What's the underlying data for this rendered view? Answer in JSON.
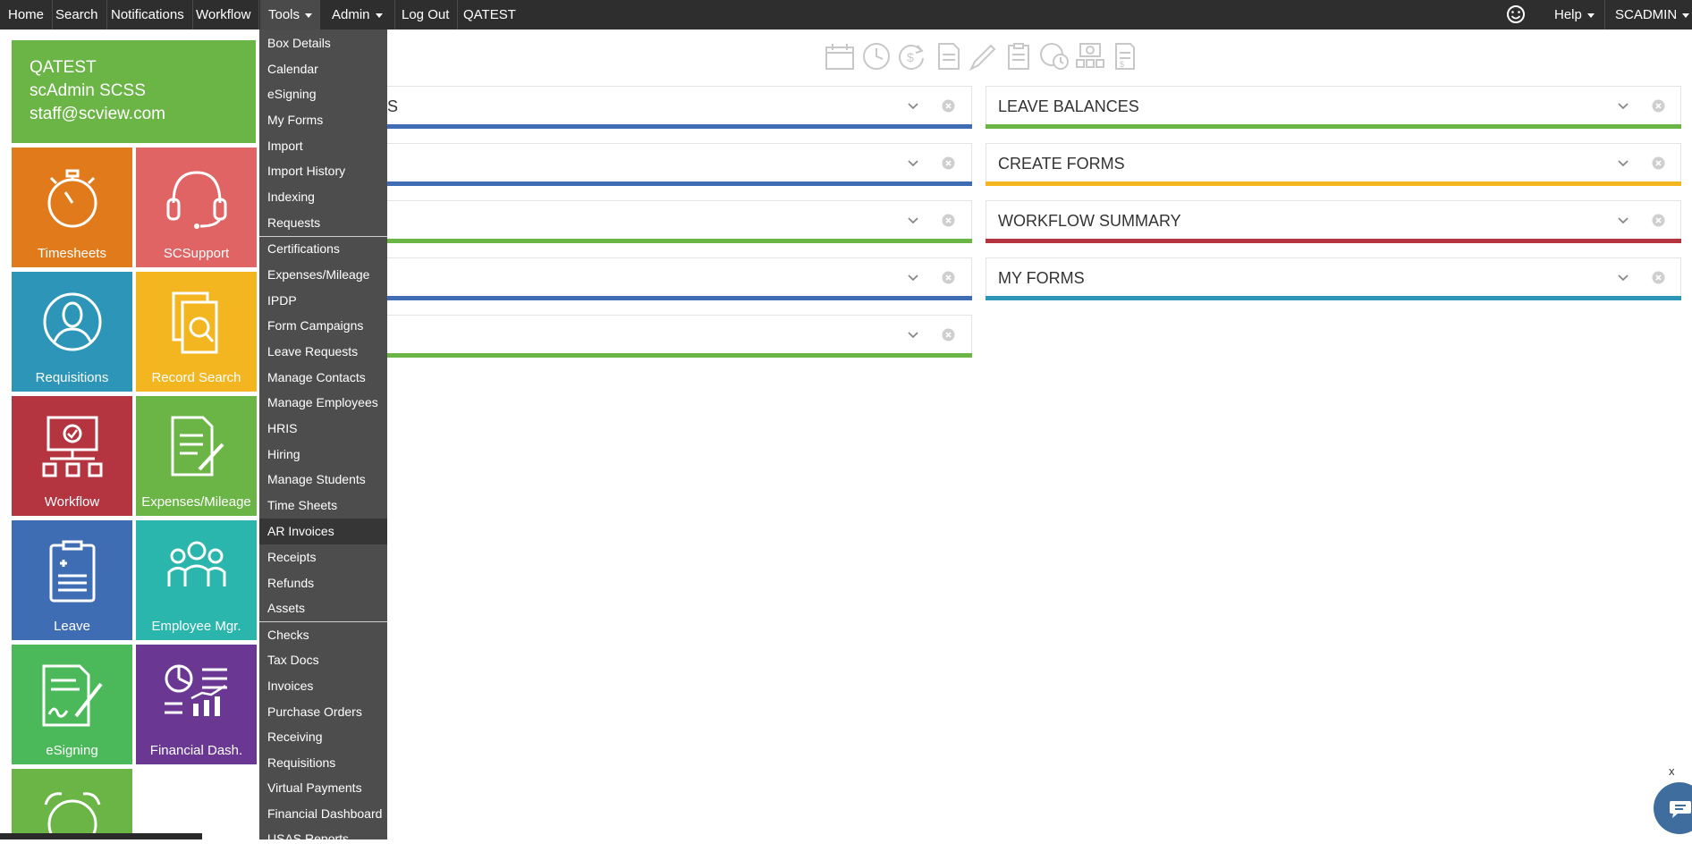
{
  "nav": {
    "home": "Home",
    "search": "Search",
    "notifications": "Notifications",
    "workflow": "Workflow",
    "tools": "Tools",
    "admin": "Admin",
    "logout": "Log Out",
    "site": "QATEST",
    "help": "Help",
    "user": "SCADMIN"
  },
  "user": {
    "site": "QATEST",
    "name": "scAdmin SCSS",
    "email": "staff@scview.com"
  },
  "tiles": [
    {
      "label": "Timesheets",
      "color": "#e07a1b",
      "icon": "stopwatch-icon"
    },
    {
      "label": "SCSupport",
      "color": "#e06464",
      "icon": "headset-icon"
    },
    {
      "label": "Requisitions",
      "color": "#2c95b8",
      "icon": "person-icon"
    },
    {
      "label": "Record Search",
      "color": "#f3b621",
      "icon": "document-search-icon"
    },
    {
      "label": "Workflow",
      "color": "#b4343f",
      "icon": "workflow-icon"
    },
    {
      "label": "Expenses/Mileage",
      "color": "#6ab545",
      "icon": "document-pen-icon"
    },
    {
      "label": "Leave",
      "color": "#3f6db3",
      "icon": "clipboard-icon"
    },
    {
      "label": "Employee Mgr.",
      "color": "#2ab5ad",
      "icon": "people-icon"
    },
    {
      "label": "eSigning",
      "color": "#4bb85a",
      "icon": "signature-icon"
    },
    {
      "label": "Financial Dash.",
      "color": "#6a3893",
      "icon": "chart-icon"
    },
    {
      "label": "",
      "color": "#6ab545",
      "icon": "alarm-clock-icon"
    }
  ],
  "tools_menu": [
    "Box Details",
    "Calendar",
    "eSigning",
    "My Forms",
    "Import",
    "Import History",
    "Indexing",
    "Requests",
    "Certifications",
    "Expenses/Mileage",
    "IPDP",
    "Form Campaigns",
    "Leave Requests",
    "Manage Contacts",
    "Manage Employees",
    "HRIS",
    "Hiring",
    "Manage Students",
    "Time Sheets",
    "AR Invoices",
    "Receipts",
    "Refunds",
    "Assets",
    "Checks",
    "Tax Docs",
    "Invoices",
    "Purchase Orders",
    "Receiving",
    "Requisitions",
    "Virtual Payments",
    "Financial Dashboard",
    "USAS Reports"
  ],
  "tools_menu_highlighted": "AR Invoices",
  "toolbar_icons": [
    "calendar-icon",
    "clock-icon",
    "money-cycle-icon",
    "document-icon",
    "pencil-icon",
    "clipboard-check-icon",
    "user-clock-icon",
    "cash-register-icon",
    "receipt-icon"
  ],
  "widgets_left": [
    {
      "title": "S",
      "color": "#3f6db3"
    },
    {
      "title": "",
      "color": "#3f6db3"
    },
    {
      "title": "",
      "color": "#6ab545"
    },
    {
      "title": "",
      "color": "#3f6db3"
    },
    {
      "title": "",
      "color": "#6ab545"
    }
  ],
  "widgets_right": [
    {
      "title": "LEAVE BALANCES",
      "color": "#6ab545"
    },
    {
      "title": "CREATE FORMS",
      "color": "#f3b621"
    },
    {
      "title": "WORKFLOW SUMMARY",
      "color": "#b4343f"
    },
    {
      "title": "MY FORMS",
      "color": "#2c95b8"
    }
  ],
  "chat": {
    "close": "x"
  }
}
